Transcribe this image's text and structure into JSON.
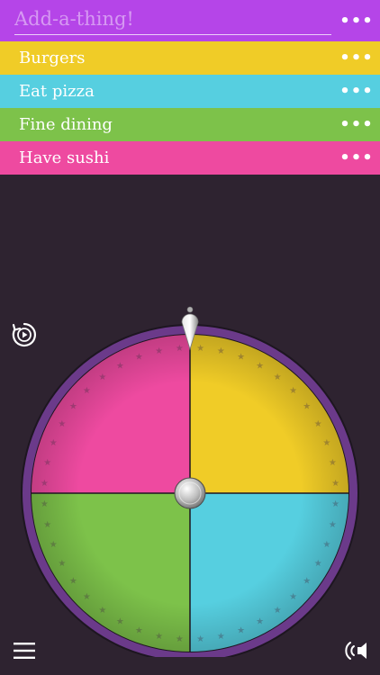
{
  "add": {
    "placeholder": "Add-a-thing!",
    "value": ""
  },
  "items": [
    {
      "label": "Burgers",
      "color": "#f0cc27"
    },
    {
      "label": "Eat pizza",
      "color": "#56cfe0"
    },
    {
      "label": "Fine dining",
      "color": "#7dc24a"
    },
    {
      "label": "Have sushi",
      "color": "#ee4aa0"
    }
  ],
  "more_glyph": "•••",
  "colors": {
    "background": "#2e2330",
    "header": "#b545e8",
    "wheel_rim": "#6b3a8a"
  },
  "icons": {
    "replay": "replay-icon",
    "menu": "hamburger-menu-icon",
    "sound": "sound-icon",
    "more": "more-dots-icon"
  },
  "wheel": {
    "segments": [
      {
        "ref": "Burgers",
        "color": "#f0cc27"
      },
      {
        "ref": "Eat pizza",
        "color": "#56cfe0"
      },
      {
        "ref": "Fine dining",
        "color": "#7dc24a"
      },
      {
        "ref": "Have sushi",
        "color": "#ee4aa0"
      }
    ]
  }
}
